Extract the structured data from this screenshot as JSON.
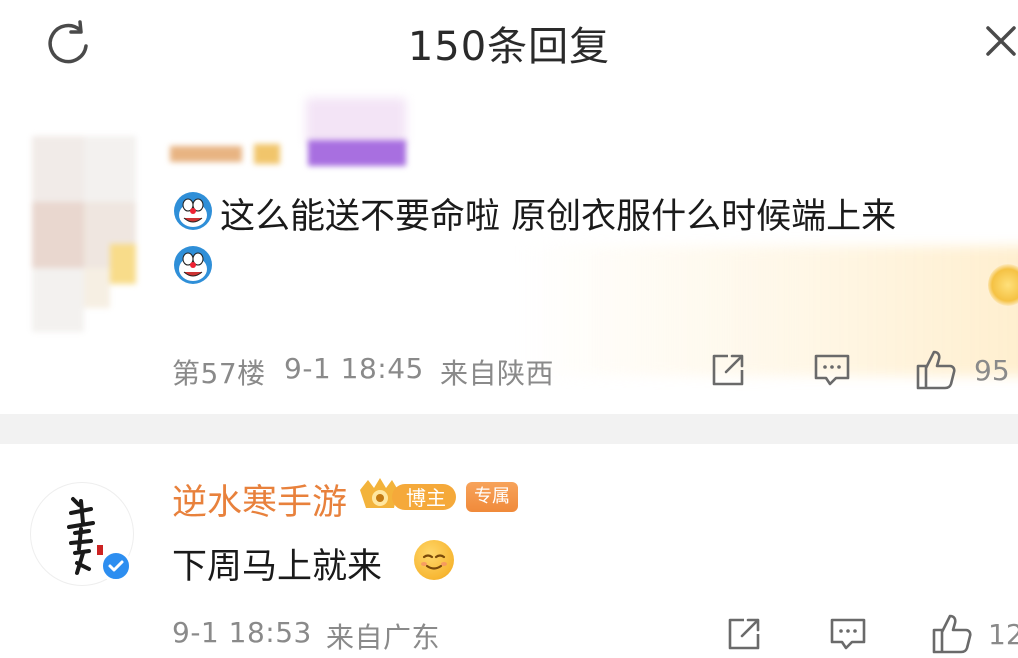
{
  "header": {
    "title": "150条回复",
    "refresh_icon": "refresh-icon",
    "close_icon": "close-icon"
  },
  "comments": [
    {
      "username": "",
      "text": "这么能送不要命啦 原创衣服什么时候端上来",
      "emoji": "doraemon-emoji",
      "floor": "第57楼",
      "time": "9-1 18:45",
      "location": "来自陕西",
      "likes": "95"
    },
    {
      "username": "逆水寒手游",
      "badges": [
        "博主",
        "专属"
      ],
      "text": "下周马上就来",
      "emoji": "smile-emoji",
      "time": "9-1 18:53",
      "location": "来自广东",
      "likes": "12"
    }
  ],
  "colors": {
    "username_orange": "#e8813c",
    "meta_gray": "#8a8a8a",
    "divider": "#f2f2f2",
    "verified_blue": "#2d8ef0"
  }
}
